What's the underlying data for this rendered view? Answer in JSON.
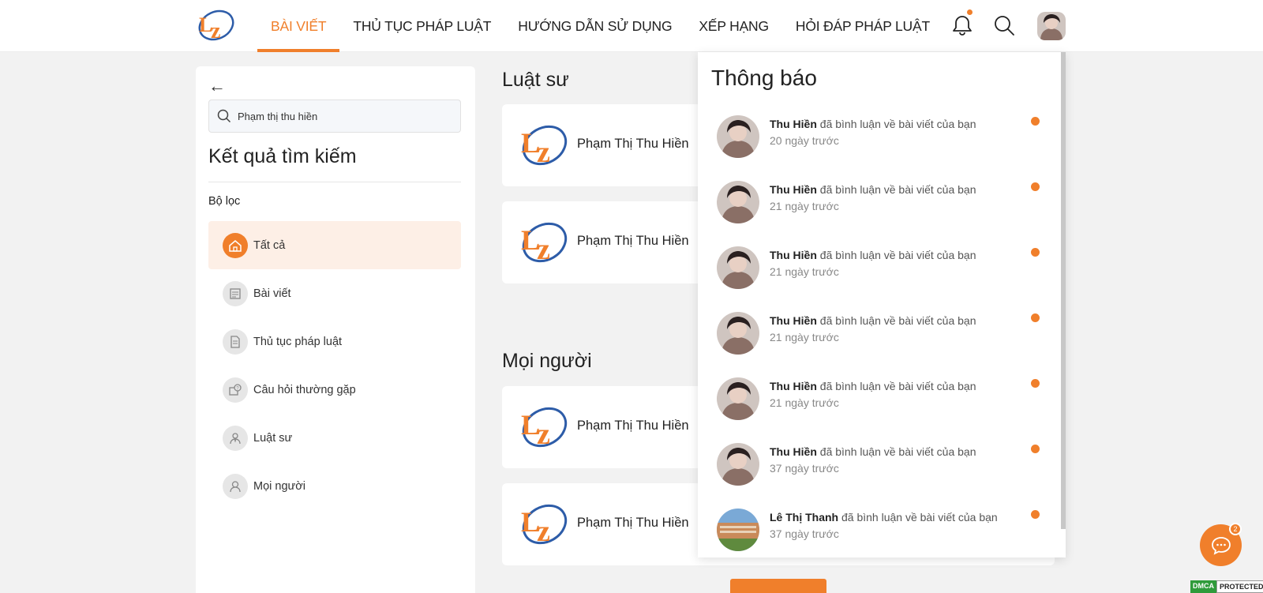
{
  "header": {
    "nav": [
      {
        "label": "BÀI VIẾT",
        "active": true
      },
      {
        "label": "THỦ TỤC PHÁP LUẬT",
        "active": false
      },
      {
        "label": "HƯỚNG DẪN SỬ DỤNG",
        "active": false
      },
      {
        "label": "XẾP HẠNG",
        "active": false
      },
      {
        "label": "HỎI ĐÁP PHÁP LUẬT",
        "active": false
      }
    ],
    "icons": [
      "bell-icon",
      "search-icon",
      "user-avatar"
    ]
  },
  "sidebar": {
    "search_value": "Phạm thị thu hiền",
    "results_title": "Kết quả tìm kiếm",
    "filter_label": "Bộ lọc",
    "filters": [
      {
        "label": "Tất cả",
        "icon": "home-icon",
        "active": true
      },
      {
        "label": "Bài viết",
        "icon": "article-icon",
        "active": false
      },
      {
        "label": "Thủ tục pháp luật",
        "icon": "document-icon",
        "active": false
      },
      {
        "label": "Câu hỏi thường gặp",
        "icon": "question-icon",
        "active": false
      },
      {
        "label": "Luật sư",
        "icon": "lawyer-icon",
        "active": false
      },
      {
        "label": "Mọi người",
        "icon": "person-icon",
        "active": false
      }
    ]
  },
  "main": {
    "lawyers_title": "Luật sư",
    "lawyers": [
      {
        "name": "Phạm Thị Thu Hiền"
      },
      {
        "name": "Phạm Thị Thu Hiền"
      }
    ],
    "people_title": "Mọi người",
    "people": [
      {
        "name": "Phạm Thị Thu Hiền"
      },
      {
        "name": "Phạm Thị Thu Hiền"
      }
    ]
  },
  "notifications": {
    "title": "Thông báo",
    "items": [
      {
        "user": "Thu Hiền",
        "action": "đã bình luận về bài viết của bạn",
        "time": "20 ngày trước"
      },
      {
        "user": "Thu Hiền",
        "action": "đã bình luận về bài viết của bạn",
        "time": "21 ngày trước"
      },
      {
        "user": "Thu Hiền",
        "action": "đã bình luận về bài viết của bạn",
        "time": "21 ngày trước"
      },
      {
        "user": "Thu Hiền",
        "action": "đã bình luận về bài viết của bạn",
        "time": "21 ngày trước"
      },
      {
        "user": "Thu Hiền",
        "action": "đã bình luận về bài viết của bạn",
        "time": "21 ngày trước"
      },
      {
        "user": "Thu Hiền",
        "action": "đã bình luận về bài viết của bạn",
        "time": "37 ngày trước"
      },
      {
        "user": "Lê Thị Thanh",
        "action": "đã bình luận về bài viết của bạn",
        "time": "37 ngày trước"
      }
    ]
  },
  "chat": {
    "badge": "2"
  },
  "dmca": {
    "left": "DMCA",
    "right": "PROTECTED"
  },
  "colors": {
    "accent": "#f07f2b",
    "background": "#f2f2f2"
  }
}
